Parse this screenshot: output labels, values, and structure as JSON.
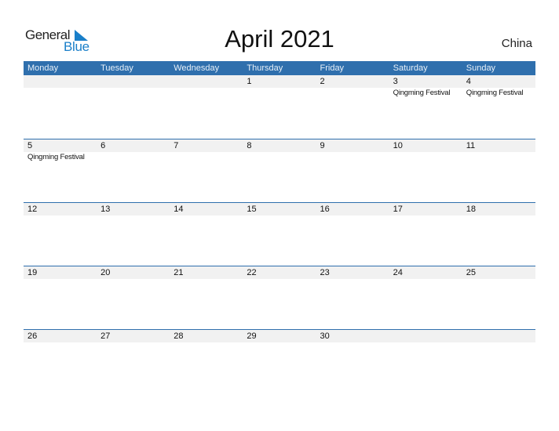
{
  "logo": {
    "word1": "General",
    "word2": "Blue"
  },
  "title": "April 2021",
  "country": "China",
  "weekdays": [
    "Monday",
    "Tuesday",
    "Wednesday",
    "Thursday",
    "Friday",
    "Saturday",
    "Sunday"
  ],
  "weeks": [
    [
      {
        "date": "",
        "event": ""
      },
      {
        "date": "",
        "event": ""
      },
      {
        "date": "",
        "event": ""
      },
      {
        "date": "1",
        "event": ""
      },
      {
        "date": "2",
        "event": ""
      },
      {
        "date": "3",
        "event": "Qingming Festival"
      },
      {
        "date": "4",
        "event": "Qingming Festival"
      }
    ],
    [
      {
        "date": "5",
        "event": "Qingming Festival"
      },
      {
        "date": "6",
        "event": ""
      },
      {
        "date": "7",
        "event": ""
      },
      {
        "date": "8",
        "event": ""
      },
      {
        "date": "9",
        "event": ""
      },
      {
        "date": "10",
        "event": ""
      },
      {
        "date": "11",
        "event": ""
      }
    ],
    [
      {
        "date": "12",
        "event": ""
      },
      {
        "date": "13",
        "event": ""
      },
      {
        "date": "14",
        "event": ""
      },
      {
        "date": "15",
        "event": ""
      },
      {
        "date": "16",
        "event": ""
      },
      {
        "date": "17",
        "event": ""
      },
      {
        "date": "18",
        "event": ""
      }
    ],
    [
      {
        "date": "19",
        "event": ""
      },
      {
        "date": "20",
        "event": ""
      },
      {
        "date": "21",
        "event": ""
      },
      {
        "date": "22",
        "event": ""
      },
      {
        "date": "23",
        "event": ""
      },
      {
        "date": "24",
        "event": ""
      },
      {
        "date": "25",
        "event": ""
      }
    ],
    [
      {
        "date": "26",
        "event": ""
      },
      {
        "date": "27",
        "event": ""
      },
      {
        "date": "28",
        "event": ""
      },
      {
        "date": "29",
        "event": ""
      },
      {
        "date": "30",
        "event": ""
      },
      {
        "date": "",
        "event": ""
      },
      {
        "date": "",
        "event": ""
      }
    ]
  ],
  "colors": {
    "header_bg": "#2f6fad",
    "brand_blue": "#1a7fc9",
    "date_band": "#f1f1f1"
  }
}
